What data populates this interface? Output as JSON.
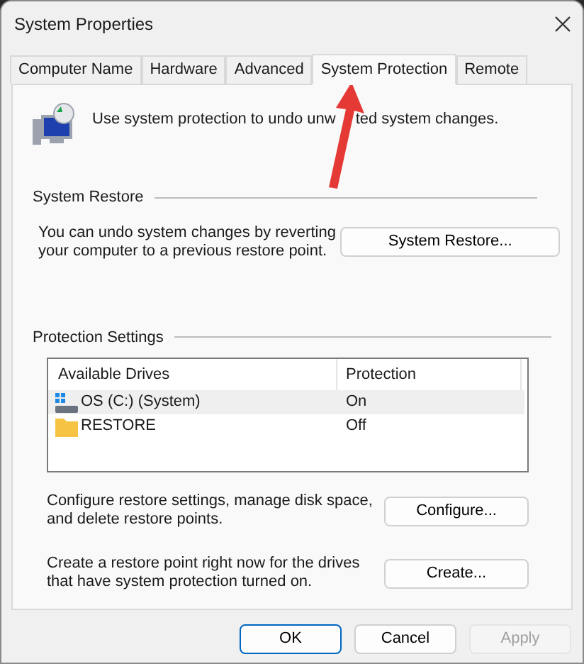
{
  "window": {
    "title": "System Properties"
  },
  "tabs": [
    {
      "label": "Computer Name",
      "selected": false
    },
    {
      "label": "Hardware",
      "selected": false
    },
    {
      "label": "Advanced",
      "selected": false
    },
    {
      "label": "System Protection",
      "selected": true
    },
    {
      "label": "Remote",
      "selected": false
    }
  ],
  "intro": [
    "Use system protection to undo unw",
    "ted system changes."
  ],
  "system_restore": {
    "heading": "System Restore",
    "description": "You can undo system changes by reverting your computer to a previous restore point.",
    "button": "System Restore..."
  },
  "protection_settings": {
    "heading": "Protection Settings",
    "columns": [
      "Available Drives",
      "Protection"
    ],
    "rows": [
      {
        "kind": "system",
        "drive": "OS (C:) (System)",
        "protection": "On",
        "selected": true
      },
      {
        "kind": "folder",
        "drive": "RESTORE",
        "protection": "Off",
        "selected": false
      }
    ],
    "actions": [
      {
        "text": "Configure restore settings, manage disk space, and delete restore points.",
        "button": "Configure..."
      },
      {
        "text": "Create a restore point right now for the drives that have system protection turned on.",
        "button": "Create..."
      }
    ]
  },
  "buttons": [
    {
      "label": "OK",
      "default": true,
      "disabled": false
    },
    {
      "label": "Cancel",
      "default": false,
      "disabled": false
    },
    {
      "label": "Apply",
      "default": false,
      "disabled": true
    }
  ]
}
